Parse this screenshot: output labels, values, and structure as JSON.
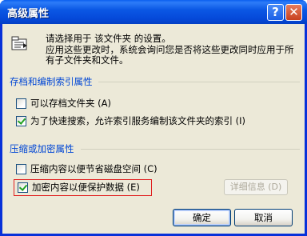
{
  "window": {
    "title": "高级属性",
    "help_glyph": "?",
    "close_glyph": "✕"
  },
  "intro": {
    "line1": "请选择用于 该文件夹 的设置。",
    "line2": "应用这些更改时，系统会询问您是否将这些更改同时应用于所有子文件夹和文件。",
    "icon": "folder-properties-icon"
  },
  "archive_group": {
    "title": "存档和编制索引属性",
    "items": [
      {
        "label": "可以存档文件夹 (A)",
        "checked": false
      },
      {
        "label": "为了快速搜索，允许索引服务编制该文件夹的索引 (I)",
        "checked": true
      }
    ]
  },
  "compress_group": {
    "title": "压缩或加密属性",
    "items": [
      {
        "label": "压缩内容以便节省磁盘空间 (C)",
        "checked": false
      },
      {
        "label": "加密内容以便保护数据 (E)",
        "checked": true,
        "highlighted": true
      }
    ],
    "details_button": "详细信息 (D)"
  },
  "buttons": {
    "ok": "确定",
    "cancel": "取消"
  },
  "colors": {
    "titlebar": "#0548d8",
    "group_title": "#0046d5",
    "dialog_bg": "#ece9d8",
    "highlight_border": "#e02020",
    "checkmark": "#21a121"
  }
}
